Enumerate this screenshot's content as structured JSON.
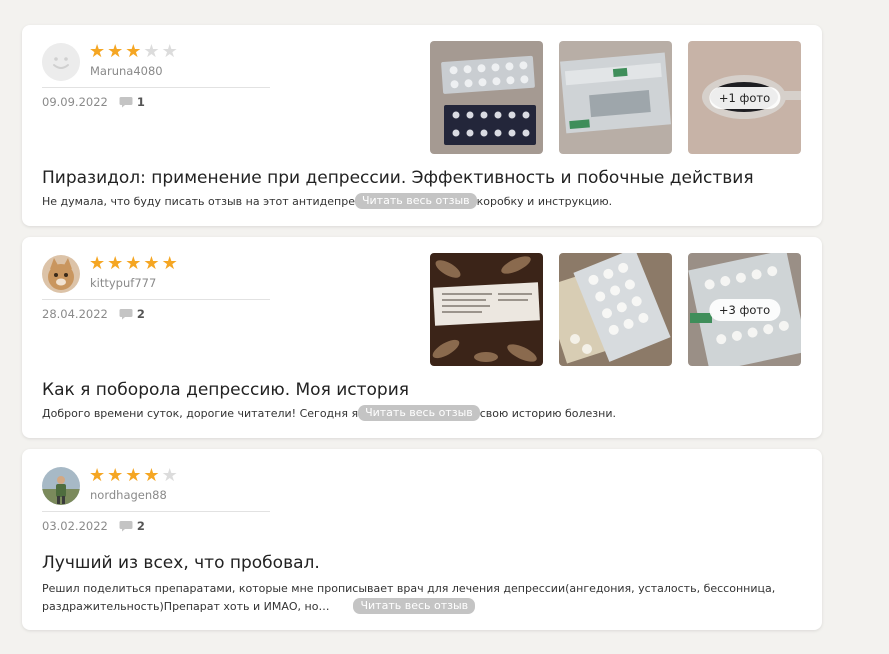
{
  "read_label": "Читать весь отзыв",
  "reviews": [
    {
      "username": "Maruna4080",
      "rating": 3,
      "date": "09.09.2022",
      "comments": "1",
      "photo_more": "+1 фото",
      "title": "Пиразидол: применение при депрессии. Эффективность и побочные действия",
      "excerpt_a": "Не думала, что буду писать отзыв на этот антидепре",
      "excerpt_b": "коробку и инструкцию."
    },
    {
      "username": "kittypuf777",
      "rating": 5,
      "date": "28.04.2022",
      "comments": "2",
      "photo_more": "+3 фото",
      "title": "Как я поборола депрессию. Моя история",
      "excerpt_a": "Доброго времени суток, дорогие читатели! Сегодня я",
      "excerpt_b": "свою историю болезни."
    },
    {
      "username": "nordhagen88",
      "rating": 4,
      "date": "03.02.2022",
      "comments": "2",
      "title": "Лучший из всех, что пробовал.",
      "excerpt_a": "Решил поделиться препаратами, которые мне прописывает врач для лечения депрессии(ангедония, усталость, бессонница, раздражительность)Препарат хоть и ИМАО, но…"
    }
  ]
}
